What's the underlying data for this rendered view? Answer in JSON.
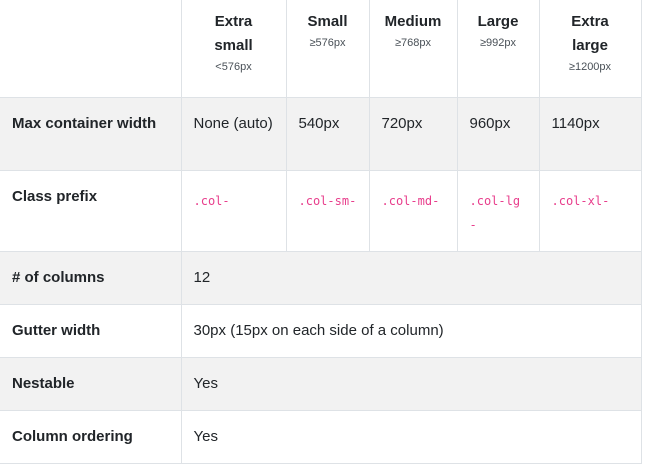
{
  "headers": {
    "corner": "",
    "cols": [
      {
        "name_line1": "Extra",
        "name_line2": "small",
        "bp": "<576px"
      },
      {
        "name_line1": "Small",
        "name_line2": "",
        "bp": "≥576px"
      },
      {
        "name_line1": "Medium",
        "name_line2": "",
        "bp": "≥768px"
      },
      {
        "name_line1": "Large",
        "name_line2": "",
        "bp": "≥992px"
      },
      {
        "name_line1": "Extra",
        "name_line2": "large",
        "bp": "≥1200px"
      }
    ]
  },
  "rows": {
    "max_container": {
      "label": "Max container width",
      "values": [
        "None (auto)",
        "540px",
        "720px",
        "960px",
        "1140px"
      ]
    },
    "class_prefix": {
      "label": "Class prefix",
      "values": [
        ".col-",
        ".col-sm-",
        ".col-md-",
        ".col-lg-",
        ".col-xl-"
      ]
    },
    "columns": {
      "label": "# of columns",
      "value": "12"
    },
    "gutter": {
      "label": "Gutter width",
      "value": "30px (15px on each side of a column)"
    },
    "nestable": {
      "label": "Nestable",
      "value": "Yes"
    },
    "ordering": {
      "label": "Column ordering",
      "value": "Yes"
    }
  },
  "colors": {
    "code": "#e83e8c",
    "stripe": "#f2f2f2",
    "border": "#dee2e6"
  }
}
